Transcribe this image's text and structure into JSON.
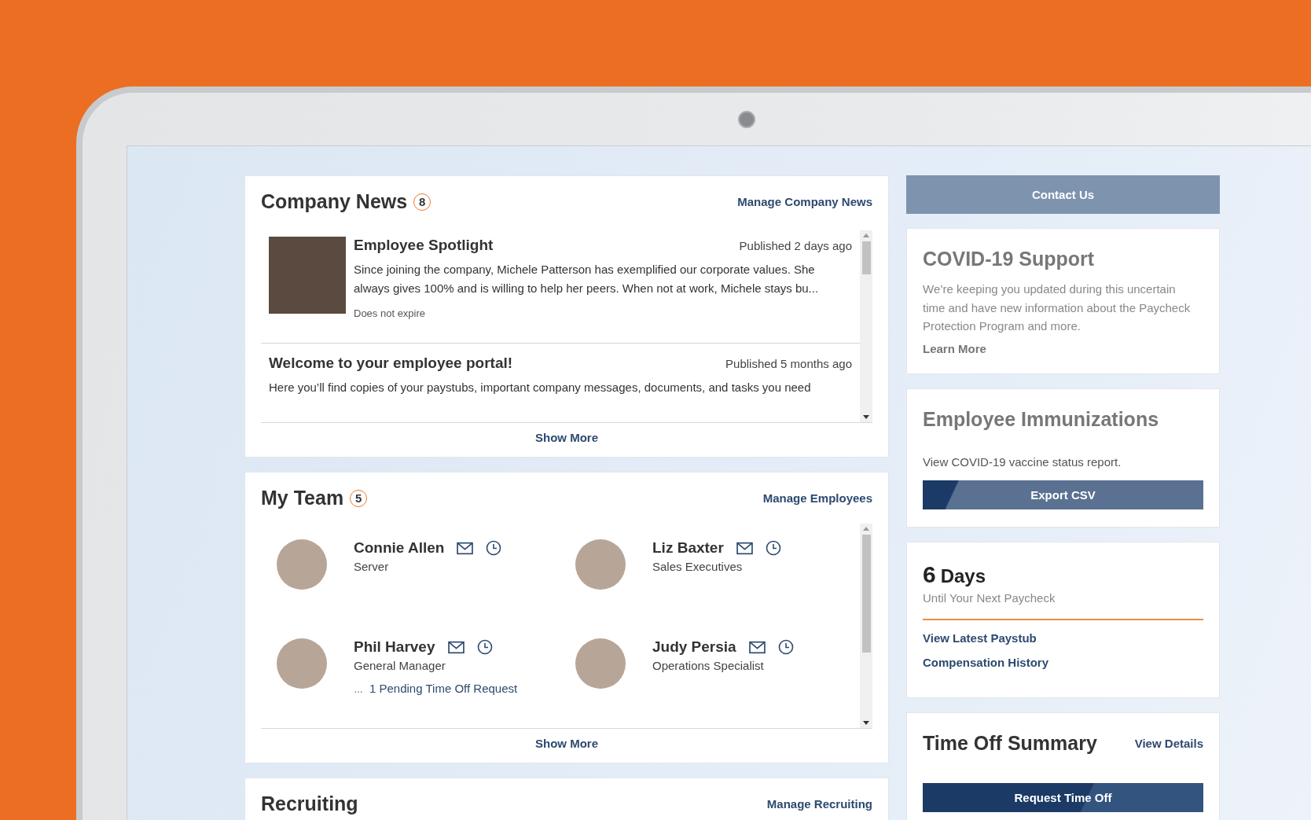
{
  "news": {
    "title": "Company News",
    "count": "8",
    "manage_link": "Manage Company News",
    "items": [
      {
        "kind": "photo",
        "title": "Employee Spotlight",
        "published": "Published 2 days ago",
        "body": "Since joining the company, Michele Patterson has exemplified our corporate values. She always gives 100% and is willing to help her peers. When not at work, Michele stays bu...",
        "expiry": "Does not expire"
      },
      {
        "kind": "text",
        "title": "Welcome to your employee portal!",
        "published": "Published 5 months ago",
        "body": "Here you’ll find copies of your paystubs, important company messages, documents, and tasks you need"
      }
    ],
    "show_more": "Show More"
  },
  "team": {
    "title": "My Team",
    "count": "5",
    "manage_link": "Manage Employees",
    "members": [
      {
        "name": "Connie Allen",
        "role": "Server"
      },
      {
        "name": "Liz Baxter",
        "role": "Sales Executives"
      },
      {
        "name": "Phil Harvey",
        "role": "General Manager",
        "note_icon": "…",
        "note": "1 Pending Time Off Request"
      },
      {
        "name": "Judy Persia",
        "role": "Operations Specialist"
      }
    ],
    "show_more": "Show More"
  },
  "recruiting": {
    "title": "Recruiting",
    "manage_link": "Manage Recruiting"
  },
  "contact_button": "Contact Us",
  "covid": {
    "title": "COVID-19 Support",
    "body": "We’re keeping you updated during this uncertain time and have new information about the Paycheck Protection Program and more.",
    "link": "Learn More"
  },
  "immunizations": {
    "title": "Employee Immunizations",
    "body": "View COVID-19 vaccine status report.",
    "button": "Export CSV"
  },
  "paycheck": {
    "number": "6",
    "unit": "Days",
    "caption": "Until Your Next Paycheck",
    "links": [
      "View Latest Paystub",
      "Compensation History"
    ]
  },
  "time_off": {
    "title": "Time Off Summary",
    "link": "View Details",
    "button": "Request Time Off"
  }
}
